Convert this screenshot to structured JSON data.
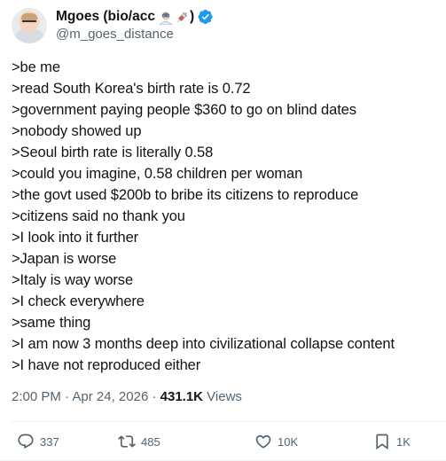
{
  "author": {
    "display_name": "Mgoes (bio/acc",
    "close_paren": ")",
    "emoji": [
      "scientist-emoji",
      "syringe-emoji"
    ],
    "handle": "@m_goes_distance",
    "verified_color": "#1d9bf0"
  },
  "post": {
    "lines": [
      ">be me",
      ">read South Korea's birth rate is 0.72",
      ">government paying people $360 to go on blind dates",
      ">nobody showed up",
      ">Seoul birth rate is literally 0.58",
      ">could you imagine, 0.58 children per woman",
      ">the govt used $200b to bribe its citizens to reproduce",
      ">citizens said no thank you",
      ">I look into it further",
      ">Japan is worse",
      ">Italy is way worse",
      ">I check everywhere",
      ">same thing",
      ">I am now 3 months deep into civilizational collapse content",
      ">I have not reproduced either"
    ]
  },
  "meta": {
    "time": "2:00 PM",
    "dot1": " · ",
    "date": "Apr 24, 2026",
    "dot2": " · ",
    "views_count": "431.1K",
    "views_label": " Views"
  },
  "actions": {
    "replies": "337",
    "reposts": "485",
    "likes": "10K",
    "bookmarks": "1K"
  },
  "colors": {
    "text": "#0f1419",
    "secondary": "#536471",
    "accent": "#1d9bf0"
  }
}
